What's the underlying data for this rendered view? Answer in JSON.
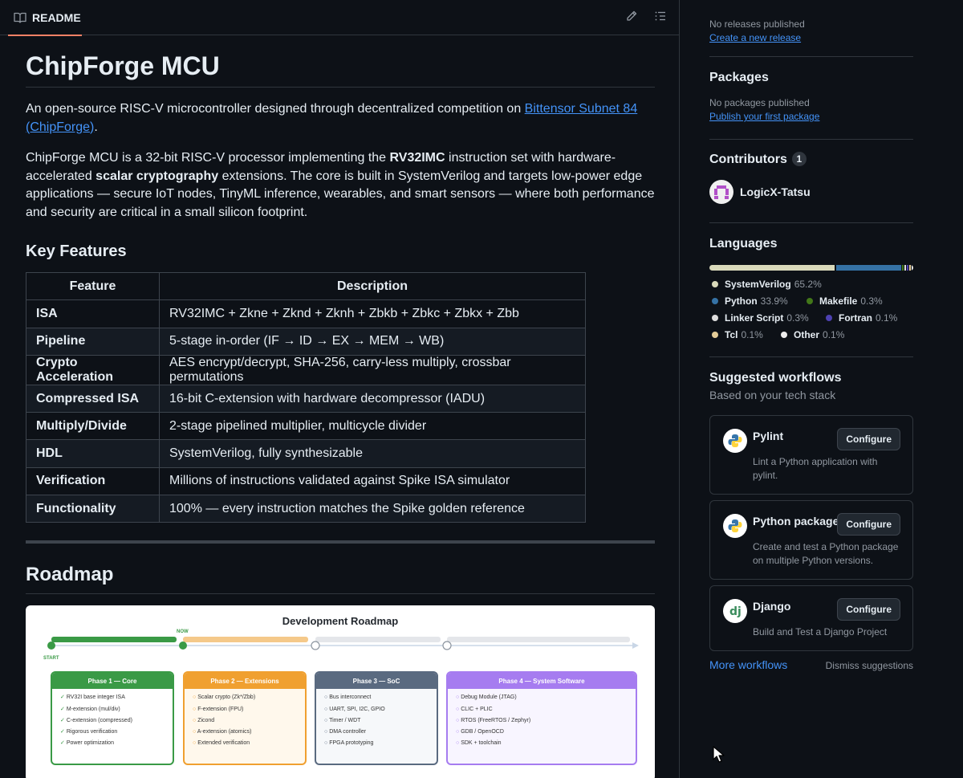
{
  "readme": {
    "tab_label": "README",
    "title": "ChipForge MCU",
    "intro_text": "An open-source RISC-V microcontroller designed through decentralized competition on ",
    "intro_link": "Bittensor Subnet 84 (ChipForge)",
    "intro_end": ".",
    "p2_a": "ChipForge MCU is a 32-bit RISC-V processor implementing the ",
    "p2_b": "RV32IMC",
    "p2_c": " instruction set with hardware-accelerated ",
    "p2_d": "scalar cryptography",
    "p2_e": " extensions. The core is built in SystemVerilog and targets low-power edge applications — secure IoT nodes, TinyML inference, wearables, and smart sensors — where both performance and security are critical in a small silicon footprint.",
    "features_heading": "Key Features",
    "table_headers": [
      "Feature",
      "Description"
    ],
    "features": [
      [
        "ISA",
        "RV32IMC + Zkne + Zknd + Zknh + Zbkb + Zbkc + Zbkx + Zbb"
      ],
      [
        "Pipeline",
        "5-stage in-order (IF → ID → EX → MEM → WB)"
      ],
      [
        "Crypto Acceleration",
        "AES encrypt/decrypt, SHA-256, carry-less multiply, crossbar permutations"
      ],
      [
        "Compressed ISA",
        "16-bit C-extension with hardware decompressor (IADU)"
      ],
      [
        "Multiply/Divide",
        "2-stage pipelined multiplier, multicycle divider"
      ],
      [
        "HDL",
        "SystemVerilog, fully synthesizable"
      ],
      [
        "Verification",
        "Millions of instructions validated against Spike ISA simulator"
      ],
      [
        "Functionality",
        "100% — every instruction matches the Spike golden reference"
      ]
    ],
    "roadmap_heading": "Roadmap",
    "roadmap": {
      "title": "Development Roadmap",
      "now_label": "NOW",
      "start_label": "START",
      "phases": [
        {
          "title": "Phase 1 — Core",
          "color": "#3a9a46",
          "bg": "#ffffff",
          "mark": "✓",
          "items": [
            "RV32I base integer ISA",
            "M-extension (mul/div)",
            "C-extension (compressed)",
            "Rigorous verification",
            "Power optimization"
          ]
        },
        {
          "title": "Phase 2 — Extensions",
          "color": "#f0a030",
          "bg": "#fff8ec",
          "mark": "○",
          "items": [
            "Scalar crypto (Zk*/Zbb)",
            "F-extension (FPU)",
            "Zicond",
            "A-extension (atomics)",
            "Extended verification"
          ]
        },
        {
          "title": "Phase 3 — SoC",
          "color": "#5a6a80",
          "bg": "#f6f8fa",
          "mark": "○",
          "items": [
            "Bus interconnect",
            "UART, SPI, I2C, GPIO",
            "Timer / WDT",
            "DMA controller",
            "FPGA prototyping"
          ]
        },
        {
          "title": "Phase 4 — System Software",
          "color": "#a67cf0",
          "bg": "#f8f5ff",
          "mark": "○",
          "items": [
            "Debug Module (JTAG)",
            "CLIC + PLIC",
            "RTOS (FreeRTOS / Zephyr)",
            "GDB / OpenOCD",
            "SDK + toolchain"
          ]
        }
      ]
    }
  },
  "sidebar": {
    "releases": {
      "empty": "No releases published",
      "link": "Create a new release"
    },
    "packages": {
      "heading": "Packages",
      "empty": "No packages published",
      "link": "Publish your first package"
    },
    "contributors": {
      "heading": "Contributors",
      "count": "1",
      "name": "LogicX-Tatsu"
    },
    "languages": {
      "heading": "Languages",
      "items": [
        {
          "name": "SystemVerilog",
          "pct": "65.2%",
          "color": "#dadabb",
          "value": 65.2
        },
        {
          "name": "Python",
          "pct": "33.9%",
          "color": "#3572a5",
          "value": 33.9
        },
        {
          "name": "Makefile",
          "pct": "0.3%",
          "color": "#427819",
          "value": 0.3
        },
        {
          "name": "Linker Script",
          "pct": "0.3%",
          "color": "#dddddd",
          "value": 0.3
        },
        {
          "name": "Fortran",
          "pct": "0.1%",
          "color": "#4d41b1",
          "value": 0.1
        },
        {
          "name": "Tcl",
          "pct": "0.1%",
          "color": "#e4cc98",
          "value": 0.1
        },
        {
          "name": "Other",
          "pct": "0.1%",
          "color": "#ededed",
          "value": 0.1
        }
      ]
    },
    "workflows": {
      "heading": "Suggested workflows",
      "subtitle": "Based on your tech stack",
      "configure_label": "Configure",
      "items": [
        {
          "name": "Pylint",
          "desc": "Lint a Python application with pylint.",
          "icon": "python-icon"
        },
        {
          "name": "Python package",
          "desc": "Create and test a Python package on multiple Python versions.",
          "icon": "python-icon"
        },
        {
          "name": "Django",
          "desc": "Build and Test a Django Project",
          "icon": "django-icon"
        }
      ],
      "more_link": "More workflows",
      "dismiss": "Dismiss suggestions"
    }
  }
}
